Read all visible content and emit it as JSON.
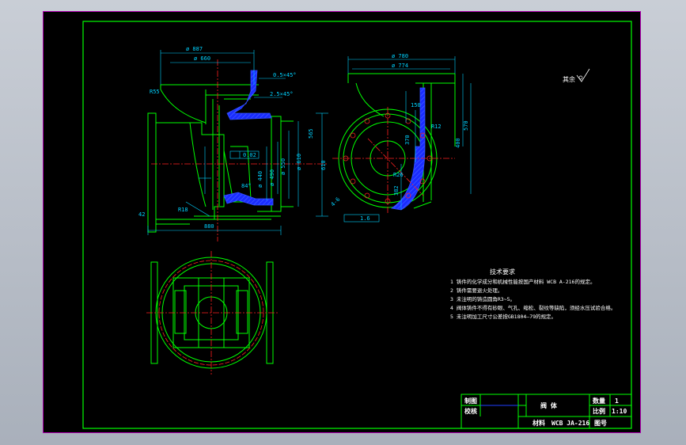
{
  "app": {
    "background": "#b8bec8",
    "canvas_bg": "#000000",
    "frame_color": "#b000b0"
  },
  "colors": {
    "outline": "#00ff00",
    "dimension": "#00d2ff",
    "centerline": "#ff2020",
    "section": "#2040ff",
    "text": "#ffffff",
    "leader": "#ffd000"
  },
  "drawing": {
    "front_view_dims": [
      "ø 887",
      "ø 660",
      "ø 610",
      "ø 550",
      "ø 490",
      "ø 440",
      "880",
      "R55",
      "0.5×45°",
      "2.5×45°",
      "0.02",
      "84°",
      "610",
      "565",
      "R18",
      "42"
    ],
    "side_view_dims": [
      "ø 780",
      "ø 774",
      "150",
      "370",
      "400",
      "570",
      "R26",
      "R12",
      "382",
      "1.6",
      "4-6"
    ],
    "roughness_label": "其余",
    "tech_requirements": {
      "title": "技术要求",
      "items": [
        "1 铸件的化学成分和机械性能按国产材料 WCB A-216的规定。",
        "2 铸件需要退火处理。",
        "3 未注明的铸造圆角R3~5。",
        "4 阀体铸件不得有砂眼、气孔、缩松、裂纹等缺陷，须经水压试验合格。",
        "5 未注明加工尺寸公差按GB1804—79的规定。"
      ]
    }
  },
  "title_block": {
    "drawn_label": "制图",
    "checked_label": "校核",
    "part_name": "阀  体",
    "qty_label": "数量",
    "qty_value": "1",
    "scale_label": "比例",
    "scale_value": "1:10",
    "material_label": "材料",
    "material_value": "WCB JA-216",
    "drawing_no_label": "图号"
  }
}
